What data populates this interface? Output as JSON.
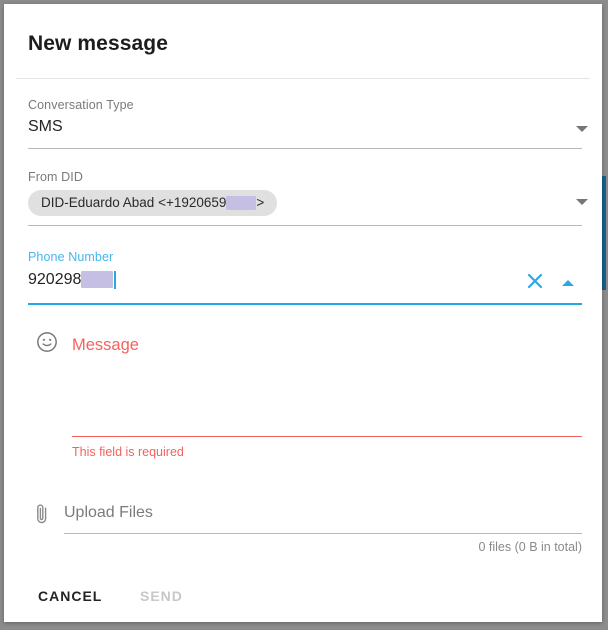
{
  "dialog": {
    "title": "New message"
  },
  "conversation_type": {
    "label": "Conversation Type",
    "value": "SMS",
    "caret_icon": "chevron-down-icon"
  },
  "from_did": {
    "label": "From DID",
    "chip_prefix": "DID-Eduardo Abad <+1920659",
    "chip_suffix": ">",
    "caret_icon": "chevron-down-icon"
  },
  "phone_number": {
    "label": "Phone Number",
    "value": "920298",
    "clear_icon": "close-icon",
    "collapse_icon": "chevron-up-icon"
  },
  "message": {
    "placeholder": "Message",
    "error": "This field is required",
    "emoji_icon": "emoji-smiley-icon"
  },
  "upload": {
    "label": "Upload Files",
    "summary": "0 files (0 B in total)",
    "attach_icon": "paperclip-icon"
  },
  "footer": {
    "cancel_label": "CANCEL",
    "send_label": "SEND"
  },
  "colors": {
    "accent_blue": "#23a9e1",
    "error_red": "#f4625f",
    "label_gray": "#7a7a7a",
    "chip_gray": "#e0e0e0",
    "redaction": "#c6bfe4",
    "app_strip_blue": "#15618c"
  }
}
